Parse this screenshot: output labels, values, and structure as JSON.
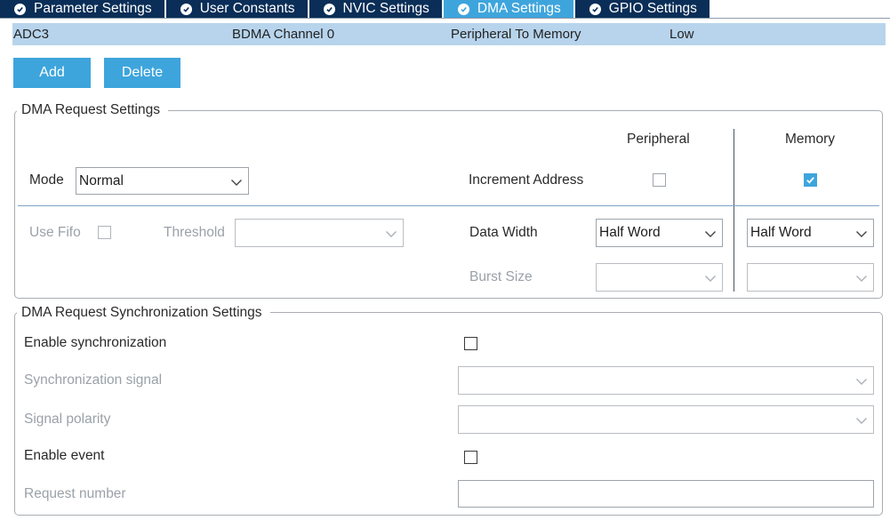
{
  "tabs": [
    {
      "label": "Parameter Settings",
      "active": false
    },
    {
      "label": "User Constants",
      "active": false
    },
    {
      "label": "NVIC Settings",
      "active": false
    },
    {
      "label": "DMA Settings",
      "active": true
    },
    {
      "label": "GPIO Settings",
      "active": false
    }
  ],
  "dma_table": {
    "rows": [
      {
        "request": "ADC3",
        "channel": "BDMA Channel 0",
        "direction": "Peripheral To Memory",
        "priority": "Low"
      }
    ]
  },
  "buttons": {
    "add": "Add",
    "delete": "Delete"
  },
  "request_settings": {
    "title": "DMA Request Settings",
    "peripheral_header": "Peripheral",
    "memory_header": "Memory",
    "mode_label": "Mode",
    "mode_value": "Normal",
    "increment_address_label": "Increment Address",
    "peripheral_increment": false,
    "memory_increment": true,
    "use_fifo_label": "Use Fifo",
    "use_fifo": false,
    "threshold_label": "Threshold",
    "threshold_value": "",
    "data_width_label": "Data Width",
    "peripheral_data_width": "Half Word",
    "memory_data_width": "Half Word",
    "burst_size_label": "Burst Size",
    "peripheral_burst_size": "",
    "memory_burst_size": ""
  },
  "sync_settings": {
    "title": "DMA Request Synchronization Settings",
    "enable_sync_label": "Enable synchronization",
    "enable_sync": false,
    "sync_signal_label": "Synchronization signal",
    "sync_signal_value": "",
    "signal_polarity_label": "Signal polarity",
    "signal_polarity_value": "",
    "enable_event_label": "Enable event",
    "enable_event": false,
    "request_number_label": "Request number",
    "request_number_value": ""
  },
  "colors": {
    "tab_bg": "#0a2e57",
    "tab_active_bg": "#3ea5dc",
    "row_selected_bg": "#b7d4ec",
    "button_bg": "#3ea5dc",
    "disabled_text": "#9aa1a8"
  }
}
